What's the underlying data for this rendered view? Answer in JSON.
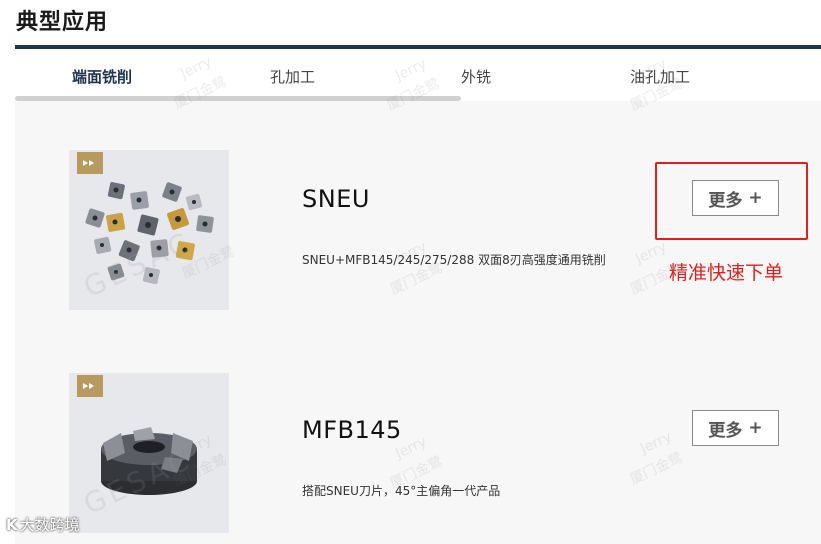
{
  "page": {
    "title": "典型应用"
  },
  "tabs": [
    {
      "label": "端面铣削",
      "active": true
    },
    {
      "label": "孔加工",
      "active": false
    },
    {
      "label": "外铣",
      "active": false
    },
    {
      "label": "油孔加工",
      "active": false
    }
  ],
  "products": [
    {
      "name": "SNEU",
      "description": "SNEU+MFB145/245/275/288 双面8刃高强度通用铣削",
      "more_label": "更多",
      "more_plus": "+"
    },
    {
      "name": "MFB145",
      "description": "搭配SNEU刀片，45°主偏角一代产品",
      "more_label": "更多",
      "more_plus": "+"
    }
  ],
  "annotation": {
    "text": "精准快速下单",
    "color": "#e02020"
  },
  "watermarks": {
    "jerry": "Jerry",
    "company": "厦门金鹭",
    "brand": "GESAC"
  },
  "corner_logo": {
    "icon": "K",
    "text": "大数跨境"
  },
  "colors": {
    "accent": "#1f3550",
    "annotation": "#e02020",
    "badge": "#b79a5e"
  }
}
